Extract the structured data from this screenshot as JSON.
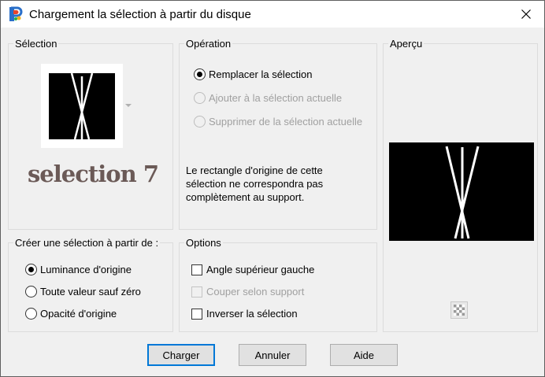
{
  "window": {
    "title": "Chargement la sélection à partir du disque",
    "icon": "paintshop-app-icon",
    "close_icon": "close-icon"
  },
  "selection_group": {
    "legend": "Sélection",
    "selected_name": "selection 7"
  },
  "operation_group": {
    "legend": "Opération",
    "options": [
      {
        "label": "Remplacer la sélection",
        "checked": true,
        "enabled": true
      },
      {
        "label": "Ajouter à la sélection actuelle",
        "checked": false,
        "enabled": false
      },
      {
        "label": "Supprimer de la sélection actuelle",
        "checked": false,
        "enabled": false
      }
    ],
    "info": "Le rectangle d'origine de cette sélection ne correspondra pas complètement au support."
  },
  "preview_group": {
    "legend": "Aperçu"
  },
  "create_from_group": {
    "legend": "Créer une sélection à partir de :",
    "options": [
      {
        "label": "Luminance d'origine",
        "checked": true
      },
      {
        "label": "Toute valeur sauf zéro",
        "checked": false
      },
      {
        "label": "Opacité d'origine",
        "checked": false
      }
    ]
  },
  "options_group": {
    "legend": "Options",
    "checkboxes": [
      {
        "label": "Angle supérieur gauche",
        "checked": false,
        "enabled": true
      },
      {
        "label": "Couper selon support",
        "checked": false,
        "enabled": false
      },
      {
        "label": "Inverser la sélection",
        "checked": false,
        "enabled": true
      }
    ]
  },
  "buttons": {
    "load": "Charger",
    "cancel": "Annuler",
    "help": "Aide"
  },
  "colors": {
    "accent": "#0078d7",
    "selection_name_color": "#6b5a57"
  }
}
